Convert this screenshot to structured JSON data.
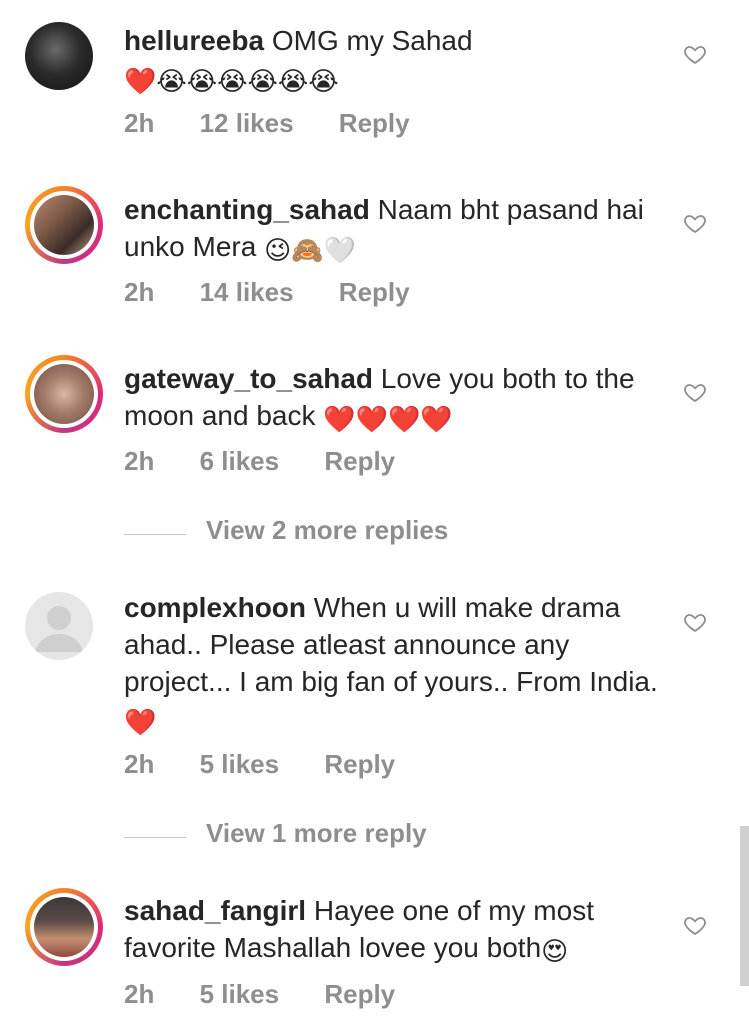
{
  "comments": [
    {
      "username": "hellureeba",
      "text": "OMG my Sahad",
      "emojis": "❤️😭😭😭😭😭😭",
      "time": "2h",
      "likes": "12 likes",
      "reply": "Reply"
    },
    {
      "username": "enchanting_sahad",
      "text": "Naam bht pasand hai unko Mera ",
      "emojis": "😉🙈🤍",
      "time": "2h",
      "likes": "14 likes",
      "reply": "Reply"
    },
    {
      "username": "gateway_to_sahad",
      "text": "Love you both to the moon and back ",
      "emojis": "❤️❤️❤️❤️",
      "time": "2h",
      "likes": "6 likes",
      "reply": "Reply"
    },
    {
      "username": "complexhoon",
      "text": "When u will make drama ahad.. Please atleast announce any project... I am big fan of yours.. From India. ",
      "emojis": "❤️",
      "time": "2h",
      "likes": "5 likes",
      "reply": "Reply"
    },
    {
      "username": "sahad_fangirl",
      "text": "Hayee one of my most favorite Mashallah lovee you both",
      "emojis": "😍",
      "time": "2h",
      "likes": "5 likes",
      "reply": "Reply"
    }
  ],
  "view_replies": [
    "View 2 more replies",
    "View 1 more reply"
  ],
  "colors": {
    "text": "#262626",
    "secondary": "#8e8e8e",
    "story_ring": "#dd2a7b"
  },
  "icons": {
    "like": "heart-outline-icon"
  }
}
